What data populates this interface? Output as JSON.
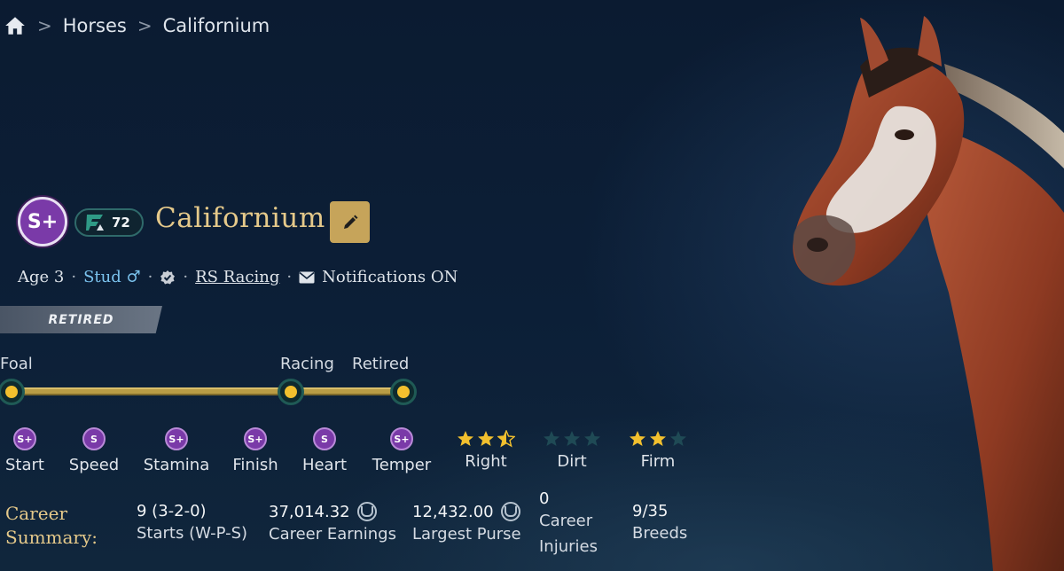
{
  "breadcrumb": {
    "items": [
      "Horses",
      "Californium"
    ]
  },
  "horse": {
    "name": "Californium",
    "grade": "S+",
    "rating": "72",
    "age": "Age 3",
    "sex": "Stud ♂",
    "owner": "RS Racing",
    "notifications": "Notifications ON",
    "status": "RETIRED"
  },
  "timeline": {
    "stages": [
      "Foal",
      "Racing",
      "Retired"
    ]
  },
  "attributes": [
    {
      "grade": "S+",
      "label": "Start"
    },
    {
      "grade": "S",
      "label": "Speed"
    },
    {
      "grade": "S+",
      "label": "Stamina"
    },
    {
      "grade": "S+",
      "label": "Finish"
    },
    {
      "grade": "S",
      "label": "Heart"
    },
    {
      "grade": "S+",
      "label": "Temper"
    }
  ],
  "surfaces": [
    {
      "label": "Right",
      "stars": 2.5
    },
    {
      "label": "Dirt",
      "stars": 0
    },
    {
      "label": "Firm",
      "stars": 2
    }
  ],
  "career": {
    "title": "Career Summary:",
    "starts": {
      "value": "9 (3-2-0)",
      "label": "Starts (W-P-S)"
    },
    "earnings": {
      "value": "37,014.32",
      "label": "Career Earnings"
    },
    "largest_purse": {
      "value": "12,432.00",
      "label": "Largest Purse"
    },
    "injuries": {
      "value": "0",
      "label_line1": "Career",
      "label_line2": "Injuries"
    },
    "breeds": {
      "value": "9/35",
      "label": "Breeds"
    }
  },
  "colors": {
    "accent_gold": "#e5c98a",
    "grade_purple": "#7a3aa8",
    "star_gold": "#f2c02e",
    "star_dim": "#1f4a55"
  },
  "icons": [
    "home-icon",
    "chevron-right-icon",
    "edit-pencil-icon",
    "verified-check-icon",
    "mail-icon",
    "coin-icon",
    "star-icon"
  ]
}
